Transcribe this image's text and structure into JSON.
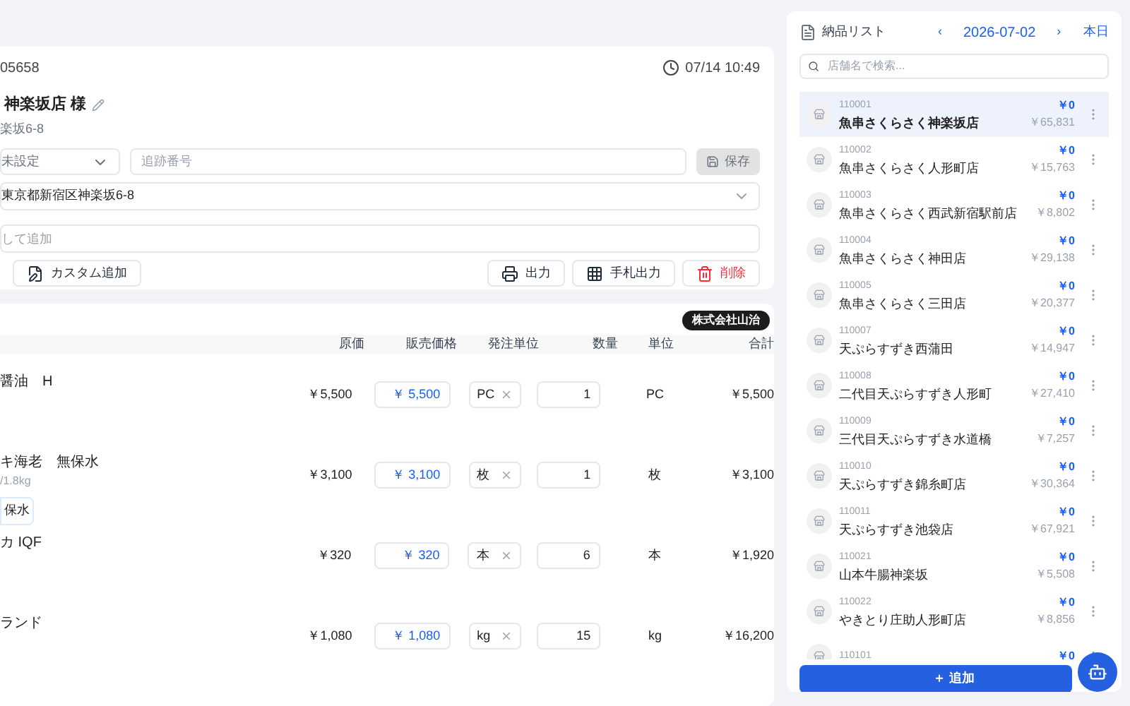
{
  "order": {
    "number": "05658",
    "time": "07/14 10:49",
    "customer": "神楽坂店 様",
    "address": "楽坂6-8",
    "status_select": "未設定",
    "tracking": {
      "placeholder": "追跡番号"
    },
    "save_button": {
      "label": "保存",
      "disabled": true
    },
    "address_select": "東京都新宿区神楽坂6-8",
    "add_field": {
      "placeholder": "して追加"
    },
    "buttons": [
      {
        "label": "カスタム追加",
        "kind": "custom"
      },
      {
        "label": "出力",
        "kind": "print"
      },
      {
        "label": "手札出力",
        "kind": "grid"
      },
      {
        "label": "削除",
        "kind": "delete"
      }
    ]
  },
  "items": {
    "supplier": "株式会社山治",
    "columns": [
      "原価",
      "販売価格",
      "発注単位",
      "数量",
      "単位",
      "合計"
    ],
    "rows": [
      {
        "name": "醤油　H",
        "cost": "￥5,500",
        "price": "￥ 5,500",
        "order_unit": "PC",
        "qty": "1",
        "unit": "PC",
        "total": "￥5,500"
      },
      {
        "name": "キ海老　無保水",
        "sub": "/1.8kg",
        "tag": "保水",
        "cost": "￥3,100",
        "price": "￥ 3,100",
        "order_unit": "枚",
        "qty": "1",
        "unit": "枚",
        "total": "￥3,100"
      },
      {
        "name": "カ IQF",
        "cost": "￥320",
        "price": "￥ 320",
        "order_unit": "本",
        "qty": "6",
        "unit": "本",
        "total": "￥1,920"
      },
      {
        "name": "ランド",
        "cost": "￥1,080",
        "price": "￥ 1,080",
        "order_unit": "kg",
        "qty": "15",
        "unit": "kg",
        "total": "￥16,200"
      }
    ]
  },
  "delivery_list": {
    "title": "納品リスト",
    "prev": "‹",
    "date": "2026-07-02",
    "next": "›",
    "today": "本日",
    "search": {
      "placeholder": "店舗名で検索..."
    },
    "stores": [
      {
        "code": "110001",
        "name": "魚串さくらさく神楽坂店",
        "amount": "￥0",
        "total": "￥65,831",
        "selected": true
      },
      {
        "code": "110002",
        "name": "魚串さくらさく人形町店",
        "amount": "￥0",
        "total": "￥15,763",
        "selected": false
      },
      {
        "code": "110003",
        "name": "魚串さくらさく西武新宿駅前店",
        "amount": "￥0",
        "total": "￥8,802",
        "selected": false
      },
      {
        "code": "110004",
        "name": "魚串さくらさく神田店",
        "amount": "￥0",
        "total": "￥29,138",
        "selected": false
      },
      {
        "code": "110005",
        "name": "魚串さくらさく三田店",
        "amount": "￥0",
        "total": "￥20,377",
        "selected": false
      },
      {
        "code": "110007",
        "name": "天ぷらすずき西蒲田",
        "amount": "￥0",
        "total": "￥14,947",
        "selected": false
      },
      {
        "code": "110008",
        "name": "二代目天ぷらすずき人形町",
        "amount": "￥0",
        "total": "￥27,410",
        "selected": false
      },
      {
        "code": "110009",
        "name": "三代目天ぷらすずき水道橋",
        "amount": "￥0",
        "total": "￥7,257",
        "selected": false
      },
      {
        "code": "110010",
        "name": "天ぷらすずき錦糸町店",
        "amount": "￥0",
        "total": "￥30,364",
        "selected": false
      },
      {
        "code": "110011",
        "name": "天ぷらすずき池袋店",
        "amount": "￥0",
        "total": "￥67,921",
        "selected": false
      },
      {
        "code": "110021",
        "name": "山本牛腸神楽坂",
        "amount": "￥0",
        "total": "￥5,508",
        "selected": false
      },
      {
        "code": "110022",
        "name": "やきとり庄助人形町店",
        "amount": "￥0",
        "total": "￥8,856",
        "selected": false
      },
      {
        "code": "110101",
        "amount": "￥0",
        "selected": false
      }
    ],
    "add_button": "＋ 追加"
  }
}
